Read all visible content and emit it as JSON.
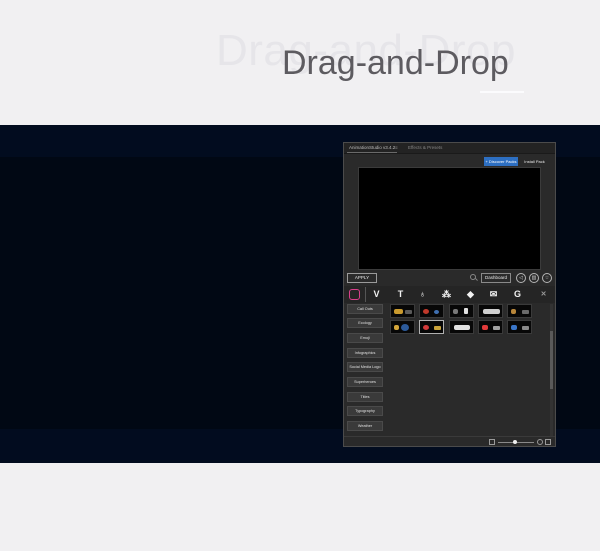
{
  "hero": {
    "ghost_text": "Drag-and-Drop",
    "title": "Drag-and-Drop"
  },
  "panel": {
    "tabs": [
      {
        "label": "AnimationStudio v3.4.2",
        "active": true
      },
      {
        "label": "Effects & Presets",
        "active": false
      }
    ],
    "tab_close_glyph": "≡",
    "discover_label": "+ Discover Packs",
    "install_label": "Install Pack",
    "apply_label": "APPLY",
    "dashboard_label": "Dashboard",
    "category_icons": [
      "instagram-icon",
      "v-logo-icon",
      "text-tool-icon",
      "pin-icon",
      "nodes-icon",
      "gem-icon",
      "mail-icon",
      "g-logo-icon",
      "tools-icon"
    ],
    "sidebar": [
      "Call Outs",
      "Ecology",
      "Emoji",
      "Infographics",
      "Social Media Logo",
      "Superheroes",
      "Titles",
      "Typography",
      "Weather"
    ],
    "accent_color": "#2d6fc2"
  }
}
